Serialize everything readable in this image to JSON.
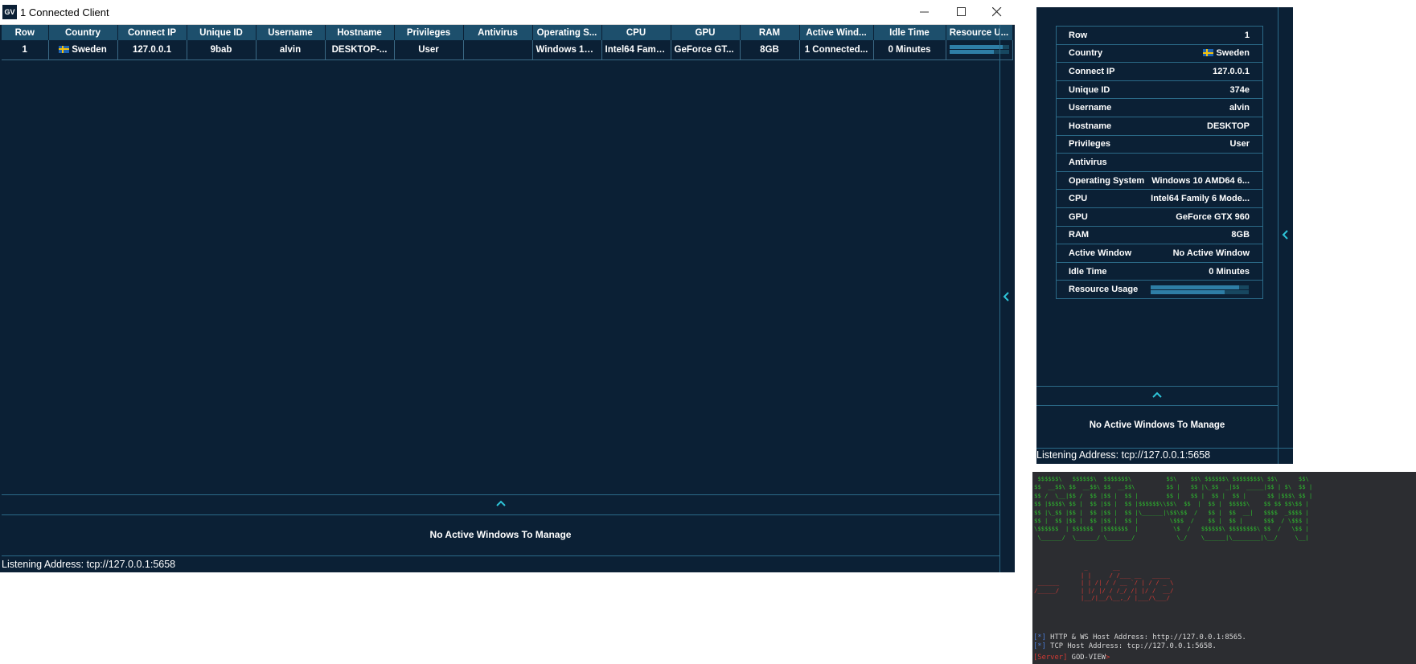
{
  "main_window": {
    "app_icon": "GV",
    "title": "1 Connected Client",
    "table": {
      "columns": [
        "Row",
        "Country",
        "Connect IP",
        "Unique ID",
        "Username",
        "Hostname",
        "Privileges",
        "Antivirus",
        "Operating S...",
        "CPU",
        "GPU",
        "RAM",
        "Active Wind...",
        "Idle Time",
        "Resource U..."
      ],
      "rows": [
        {
          "row": "1",
          "country": "Sweden",
          "connect_ip": "127.0.0.1",
          "unique_id": "9bab",
          "username": "alvin",
          "hostname": "DESKTOP-...",
          "privileges": "User",
          "antivirus": "",
          "operating_system": "Windows 10 ...",
          "cpu": "Intel64 Famil...",
          "gpu": "GeForce GT...",
          "ram": "8GB",
          "active_window": "1 Connected...",
          "idle_time": "0 Minutes",
          "resource_usage": [
            0.9,
            0.75
          ]
        }
      ]
    },
    "no_active_windows": "No Active Windows To Manage",
    "listening_address": "Listening Address: tcp://127.0.0.1:5658"
  },
  "side_window": {
    "details": [
      {
        "key": "Row",
        "value": "1"
      },
      {
        "key": "Country",
        "value": "Sweden"
      },
      {
        "key": "Connect IP",
        "value": "127.0.0.1"
      },
      {
        "key": "Unique ID",
        "value": "374e"
      },
      {
        "key": "Username",
        "value": "alvin"
      },
      {
        "key": "Hostname",
        "value": "DESKTOP"
      },
      {
        "key": "Privileges",
        "value": "User"
      },
      {
        "key": "Antivirus",
        "value": ""
      },
      {
        "key": "Operating System",
        "value": "Windows 10 AMD64 6..."
      },
      {
        "key": "CPU",
        "value": "Intel64 Family 6 Mode..."
      },
      {
        "key": "GPU",
        "value": "GeForce GTX 960"
      },
      {
        "key": "RAM",
        "value": "8GB"
      },
      {
        "key": "Active Window",
        "value": "No Active Window"
      },
      {
        "key": "Idle Time",
        "value": "0 Minutes"
      },
      {
        "key": "Resource Usage",
        "value": ""
      }
    ],
    "resource_usage": [
      0.9,
      0.75
    ],
    "no_active_windows": "No Active Windows To Manage",
    "listening_address": "Listening Address: tcp://127.0.0.1:5658"
  },
  "terminal": {
    "banner_god_view": " $$$$$$\\   $$$$$$\\  $$$$$$$\\          $$\\    $$\\ $$$$$$\\ $$$$$$$$\\ $$\\      $$\\\n$$  __$$\\ $$  __$$\\ $$  __$$\\         $$ |   $$ |\\_$$  _|$$  _____|$$ | $\\  $$ |\n$$ /  \\__|$$ /  $$ |$$ |  $$ |        $$ |   $$ |  $$ |  $$ |      $$ |$$$\\ $$ |\n$$ |$$$$\\ $$ |  $$ |$$ |  $$ |$$$$$$\\\\$$\\  $$  |  $$ |  $$$$$\\    $$ $$ $$\\$$ |\n$$ |\\_$$ |$$ |  $$ |$$ |  $$ |\\______|\\$$\\$$  /   $$ |  $$  __|   $$$$  _$$$$ |\n$$ |  $$ |$$ |  $$ |$$ |  $$ |         \\$$$  /    $$ |  $$ |      $$$  / \\$$$ |\n\\$$$$$$  | $$$$$$  |$$$$$$$  |          \\$  /   $$$$$$\\ $$$$$$$$\\ $$  /   \\$$ |\n \\______/  \\______/ \\_______/            \\_/    \\______|\\________|\\__/     \\__|",
    "banner_wave": "              _       __\n             | |     / /___ __   _____\n ______      | | /| / / __ `/ | / / _ \\\n/_____/      | |/ |/ / /_/ /| |/ /  __/\n             |__/|__/\\__,_/ |___/\\___/",
    "lines": [
      {
        "prefix": "[*]",
        "text": " HTTP & WS Host Address: http://127.0.0.1:8565."
      },
      {
        "prefix": "[*]",
        "text": " TCP Host Address: tcp://127.0.0.1:5658."
      }
    ],
    "prompt": {
      "tag": "[Server]",
      "text": " GOD-VIEW",
      "arrow": ">"
    }
  },
  "colors": {
    "background": "#0b2035",
    "header": "#1d4f6c",
    "border": "#2b6a88",
    "accent": "#2ec4d8",
    "terminal_bg": "#2c2d31",
    "terminal_green": "#2ebd2e",
    "terminal_red": "#d43a33"
  },
  "icons": [
    "app-logo-icon",
    "minimize-icon",
    "maximize-icon",
    "close-icon",
    "chevron-left-icon",
    "chevron-up-icon",
    "sweden-flag-icon"
  ]
}
